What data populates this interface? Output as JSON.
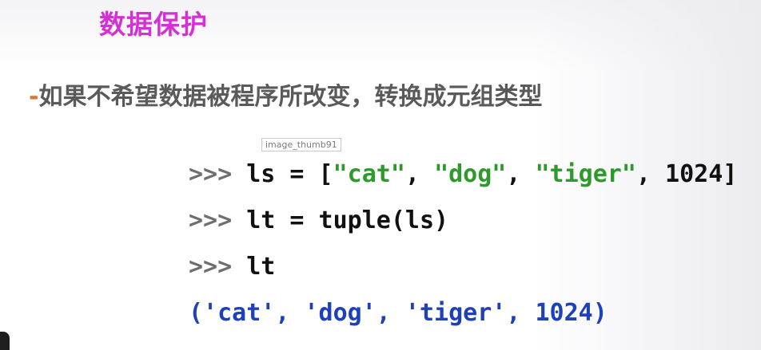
{
  "slide": {
    "title": "数据保护",
    "bullet_dash": "-",
    "bullet_text": "如果不希望数据被程序所改变，转换成元组类型",
    "tooltip": "image_thumb91",
    "code": {
      "line1": {
        "prompt": ">>> ",
        "pre": "ls = [",
        "s1": "\"cat\"",
        "sep1": ", ",
        "s2": "\"dog\"",
        "sep2": ", ",
        "s3": "\"tiger\"",
        "post": ", 1024]"
      },
      "line2": {
        "prompt": ">>> ",
        "text": "lt = tuple(ls)"
      },
      "line3": {
        "prompt": ">>> ",
        "text": "lt"
      },
      "output": "('cat', 'dog', 'tiger', 1024)"
    }
  },
  "colors": {
    "title": "#d52fd5",
    "bullet_text": "#5a5a5a",
    "string_literal": "#2e9a2e",
    "output": "#1e40b8"
  }
}
